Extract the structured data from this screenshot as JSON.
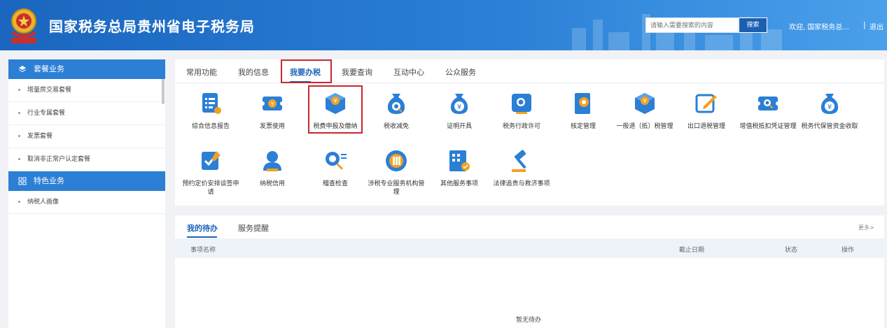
{
  "header": {
    "title": "国家税务总局贵州省电子税务局",
    "search_placeholder": "请输入需要搜索的内容",
    "search_button": "搜索",
    "welcome": "欢迎, 国家税务总...",
    "separator": "|",
    "logout": "退出"
  },
  "sidebar": {
    "section1": "套餐业务",
    "items1": [
      "增量房交易套餐",
      "行业专属套餐",
      "发票套餐",
      "取消非正常户认定套餐"
    ],
    "section2": "特色业务",
    "items2": [
      "纳税人画像"
    ]
  },
  "tabs": [
    "常用功能",
    "我的信息",
    "我要办税",
    "我要查询",
    "互动中心",
    "公众服务"
  ],
  "active_tab": "我要办税",
  "functions": [
    {
      "label": "综合信息报告",
      "icon": "report-icon"
    },
    {
      "label": "发票使用",
      "icon": "invoice-icon"
    },
    {
      "label": "税费申报及缴纳",
      "icon": "tax-declare-icon"
    },
    {
      "label": "税收减免",
      "icon": "tax-relief-icon"
    },
    {
      "label": "证明开具",
      "icon": "certificate-icon"
    },
    {
      "label": "税务行政许可",
      "icon": "license-icon"
    },
    {
      "label": "核定管理",
      "icon": "assessment-icon"
    },
    {
      "label": "一般退（抵）税管理",
      "icon": "refund-icon"
    },
    {
      "label": "出口退税管理",
      "icon": "export-refund-icon"
    },
    {
      "label": "增值税抵扣凭证管理",
      "icon": "vat-deduction-icon"
    },
    {
      "label": "税务代保管资金收取",
      "icon": "custody-fund-icon"
    },
    {
      "label": "预约定价安排谈签申请",
      "icon": "pricing-icon"
    },
    {
      "label": "纳税信用",
      "icon": "credit-icon"
    },
    {
      "label": "稽查检查",
      "icon": "inspection-icon"
    },
    {
      "label": "涉税专业服务机构管理",
      "icon": "agency-icon"
    },
    {
      "label": "其他服务事项",
      "icon": "other-services-icon"
    },
    {
      "label": "法律追责与救济事项",
      "icon": "legal-icon"
    }
  ],
  "todo": {
    "tab_active": "我的待办",
    "tab2": "服务提醒",
    "more": "更多>",
    "columns": {
      "name": "事项名称",
      "deadline": "截止日期",
      "status": "状态",
      "action": "操作"
    },
    "empty_text": "暂无待办"
  },
  "colors": {
    "header_blue": "#1a66bf",
    "accent": "#2b7fd5",
    "highlight_red": "#c8282e"
  }
}
